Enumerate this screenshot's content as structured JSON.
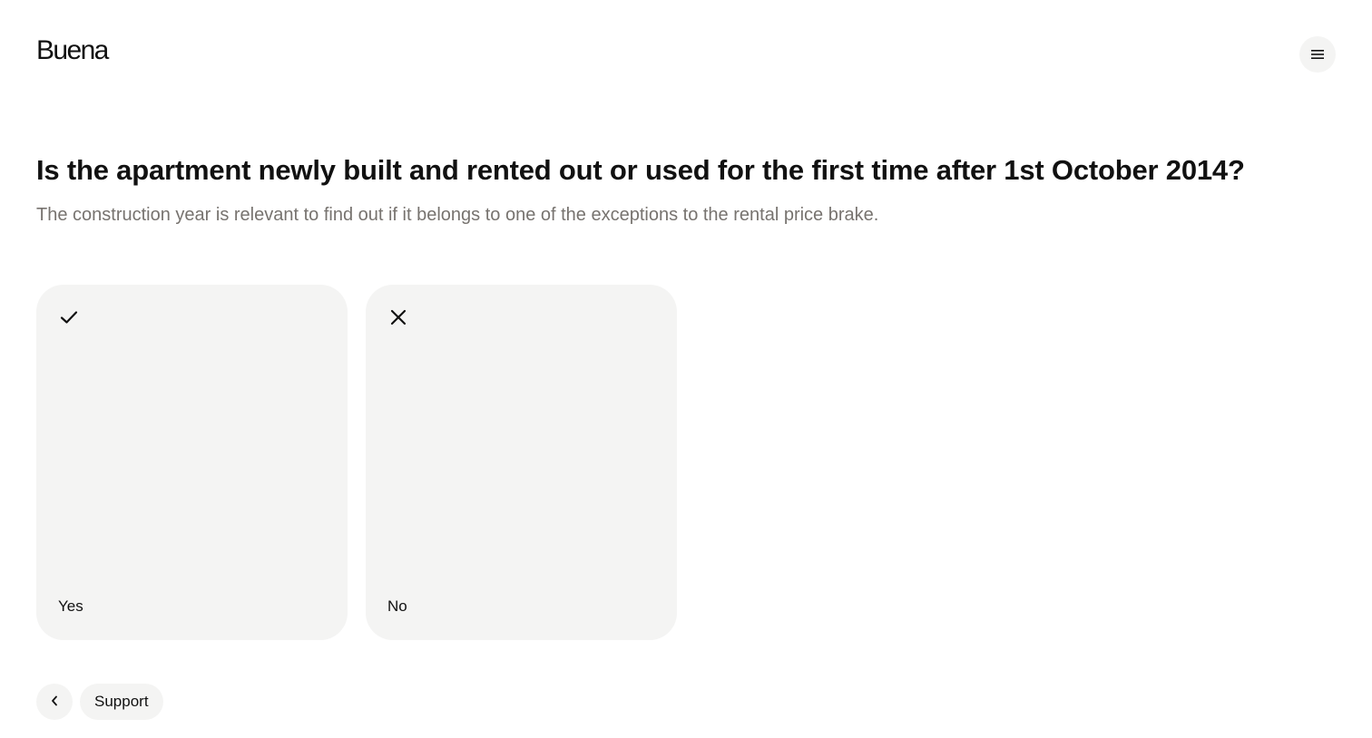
{
  "header": {
    "logo": "Buena",
    "menu_icon": "hamburger-menu-icon"
  },
  "question": {
    "title": "Is the apartment newly built and rented out or used for the first time after 1st October 2014?",
    "subtitle": "The construction year is relevant to find out if it belongs to one of the exceptions to the rental price brake."
  },
  "options": [
    {
      "label": "Yes",
      "icon": "checkmark-icon"
    },
    {
      "label": "No",
      "icon": "close-icon"
    }
  ],
  "footer": {
    "back_icon": "chevron-left-icon",
    "support_label": "Support"
  },
  "colors": {
    "card_background": "#f4f4f3",
    "subtitle_text": "#77736f",
    "primary_text": "#111111"
  }
}
